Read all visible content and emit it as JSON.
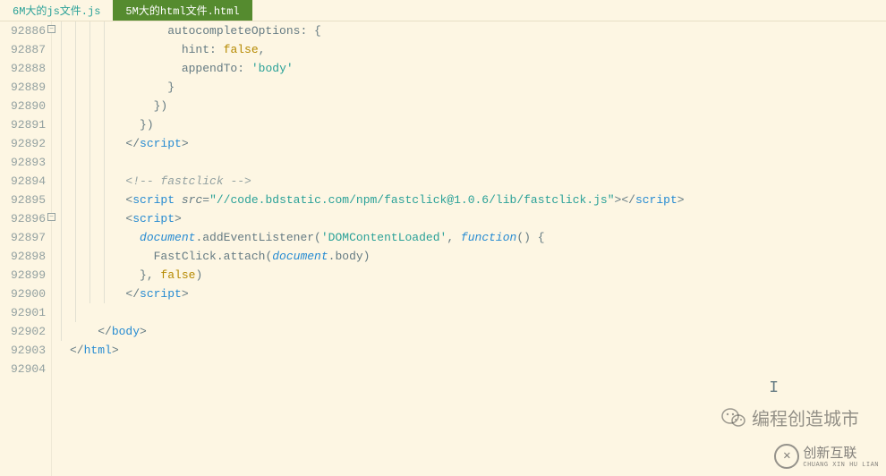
{
  "tabs": {
    "inactive": "6M大的js文件.js",
    "active": "5M大的html文件.html"
  },
  "lines": {
    "l0": "92886",
    "l1": "92887",
    "l2": "92888",
    "l3": "92889",
    "l4": "92890",
    "l5": "92891",
    "l6": "92892",
    "l7": "92893",
    "l8": "92894",
    "l9": "92895",
    "l10": "92896",
    "l11": "92897",
    "l12": "92898",
    "l13": "92899",
    "l14": "92900",
    "l15": "92901",
    "l16": "92902",
    "l17": "92903",
    "l18": "92904"
  },
  "code": {
    "autocomplete": "autocompleteOptions",
    "hint": "hint",
    "false": "false",
    "appendTo": "appendTo",
    "body_str": "'body'",
    "script": "script",
    "comment_fastclick": "<!-- fastclick -->",
    "src_attr": "src",
    "src_val": "\"//code.bdstatic.com/npm/fastclick@1.0.6/lib/fastclick.js\"",
    "document": "document",
    "addEventListener": ".addEventListener(",
    "domloaded": "'DOMContentLoaded'",
    "function": "function",
    "fastclick_attach": "FastClick.attach(",
    "body_prop": ".body)",
    "html": "html",
    "body_tag": "body"
  },
  "watermarks": {
    "wm1": "编程创造城市",
    "wm2_main": "创新互联",
    "wm2_sub": "CHUANG XIN HU LIAN"
  }
}
